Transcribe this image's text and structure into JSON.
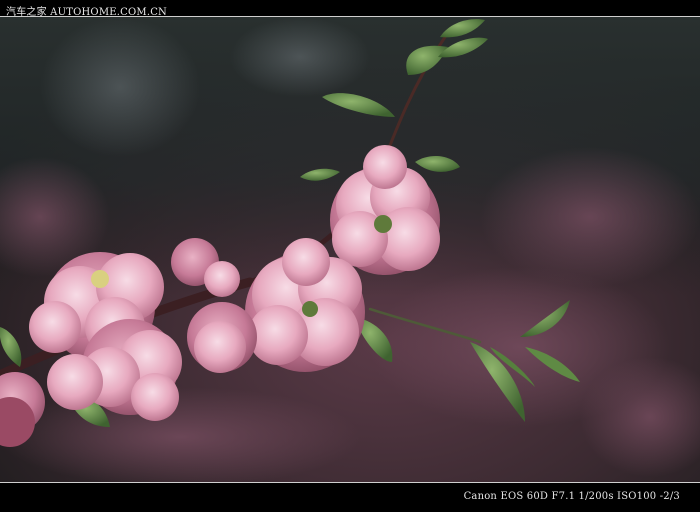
{
  "watermark": {
    "text": "汽车之家 AUTOHOME.COM.CN"
  },
  "caption": {
    "exif": "Canon EOS 60D F7.1 1/200s ISO100 -2/3"
  },
  "photo": {
    "subject": "flowering-plum-branch",
    "colors": {
      "background_dark": "#1e1c1e",
      "blossom_pink": "#e8a8bd",
      "blossom_light": "#f3d0dc",
      "leaf_green": "#5f8a44"
    }
  }
}
